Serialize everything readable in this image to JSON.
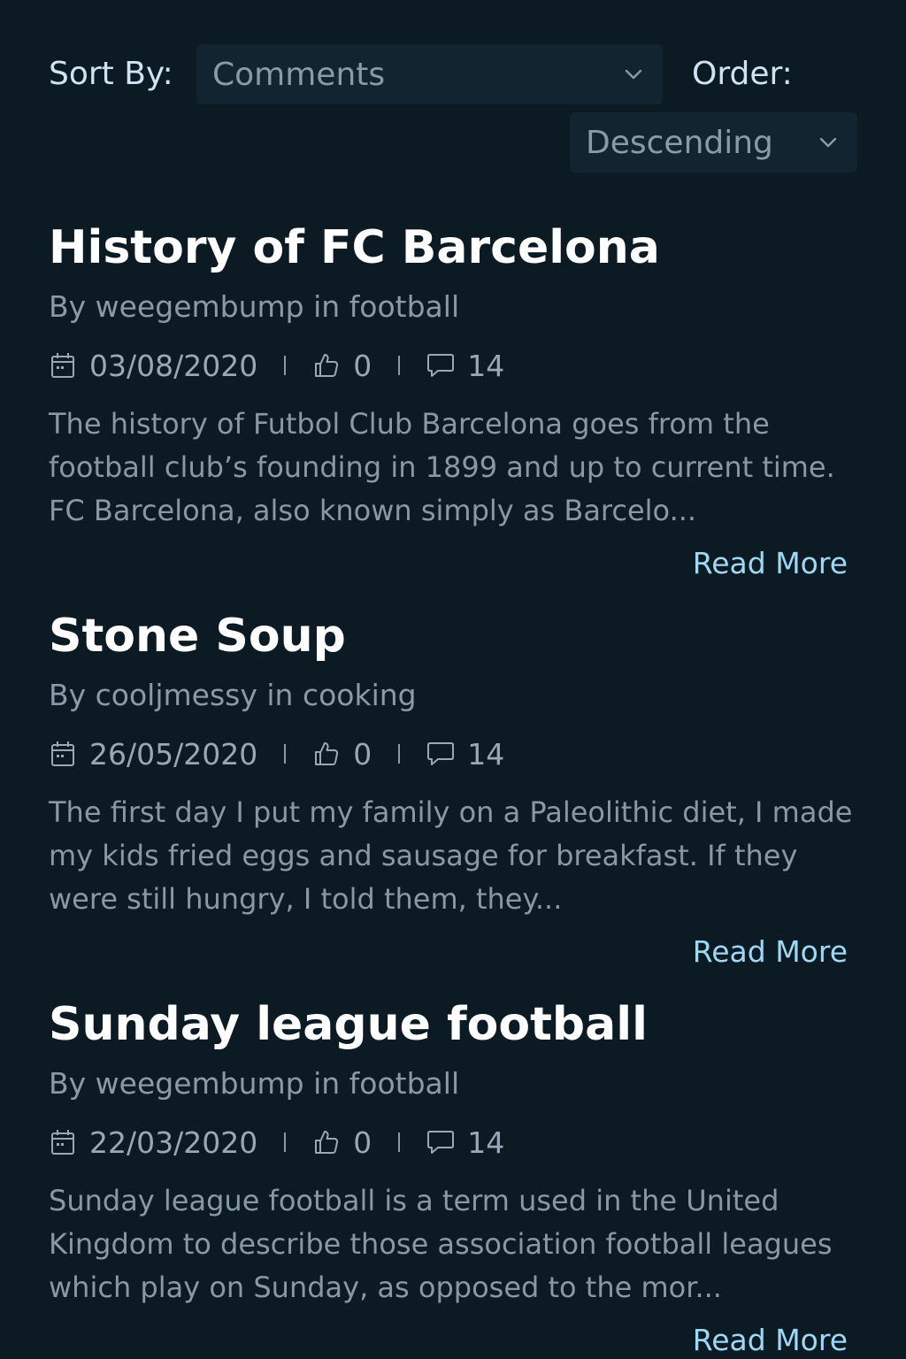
{
  "controls": {
    "sort_label": "Sort By:",
    "sort_value": "Comments",
    "order_label": "Order:",
    "order_value": "Descending"
  },
  "posts": [
    {
      "title": "History of FC Barcelona",
      "byline": "By weegembump in football",
      "date": "03/08/2020",
      "likes": "0",
      "comments": "14",
      "excerpt": "The history of Futbol Club Barcelona goes from the football club’s founding in 1899 and up to current time. FC Barcelona, also known simply as Barcelo...",
      "read_more": "Read More"
    },
    {
      "title": "Stone Soup",
      "byline": "By cooljmessy in cooking",
      "date": "26/05/2020",
      "likes": "0",
      "comments": "14",
      "excerpt": "The first day I put my family on a Paleolithic diet, I made my kids fried eggs and sausage for breakfast. If they were still hungry, I told them, they...",
      "read_more": "Read More"
    },
    {
      "title": "Sunday league football",
      "byline": "By weegembump in football",
      "date": "22/03/2020",
      "likes": "0",
      "comments": "14",
      "excerpt": "Sunday league football is a term used in the United Kingdom to describe those association football leagues which play on Sunday, as opposed to the mor...",
      "read_more": "Read More"
    }
  ],
  "icons": {
    "calendar": "calendar-icon",
    "like": "thumbs-up-icon",
    "comment": "comment-icon",
    "chevron": "chevron-down-icon"
  },
  "colors": {
    "background": "#0c1a24",
    "select_bg": "#112430",
    "link": "#9fd8f5",
    "title": "#ffffff",
    "muted": "#8a9aa6"
  }
}
